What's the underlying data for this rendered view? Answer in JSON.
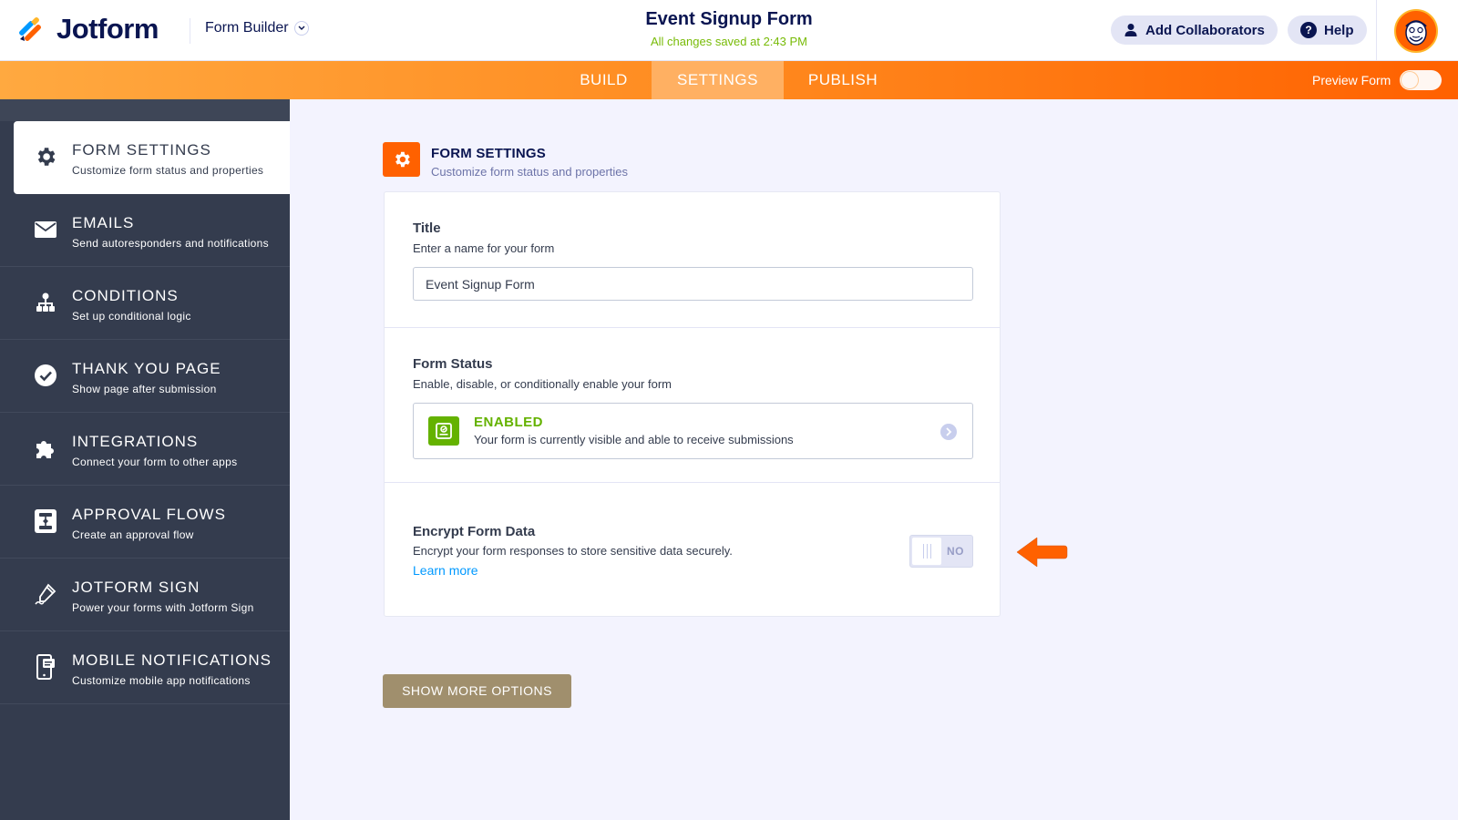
{
  "header": {
    "brand": "Jotform",
    "builder_label": "Form Builder",
    "form_name": "Event Signup Form",
    "save_status": "All changes saved at 2:43 PM",
    "collaborators_label": "Add Collaborators",
    "help_label": "Help"
  },
  "tabs": {
    "build": "BUILD",
    "settings": "SETTINGS",
    "publish": "PUBLISH",
    "active": "SETTINGS"
  },
  "preview": {
    "label": "Preview Form",
    "on": false
  },
  "sidebar": {
    "items": [
      {
        "title": "FORM SETTINGS",
        "subtitle": "Customize form status and properties",
        "icon": "gear-icon",
        "active": true
      },
      {
        "title": "EMAILS",
        "subtitle": "Send autoresponders and notifications",
        "icon": "envelope-icon"
      },
      {
        "title": "CONDITIONS",
        "subtitle": "Set up conditional logic",
        "icon": "hierarchy-icon"
      },
      {
        "title": "THANK YOU PAGE",
        "subtitle": "Show page after submission",
        "icon": "check-circle-icon"
      },
      {
        "title": "INTEGRATIONS",
        "subtitle": "Connect your form to other apps",
        "icon": "puzzle-icon"
      },
      {
        "title": "APPROVAL FLOWS",
        "subtitle": "Create an approval flow",
        "icon": "approval-flow-icon"
      },
      {
        "title": "JOTFORM SIGN",
        "subtitle": "Power your forms with Jotform Sign",
        "icon": "pen-sign-icon"
      },
      {
        "title": "MOBILE NOTIFICATIONS",
        "subtitle": "Customize mobile app notifications",
        "icon": "mobile-notification-icon"
      }
    ]
  },
  "main": {
    "section_title": "FORM SETTINGS",
    "section_subtitle": "Customize form status and properties",
    "title_field": {
      "label": "Title",
      "description": "Enter a name for your form",
      "value": "Event Signup Form"
    },
    "status_field": {
      "label": "Form Status",
      "description": "Enable, disable, or conditionally enable your form",
      "status": "ENABLED",
      "status_description": "Your form is currently visible and able to receive submissions"
    },
    "encrypt_field": {
      "label": "Encrypt Form Data",
      "description": "Encrypt your form responses to store sensitive data securely.",
      "link": "Learn more",
      "toggle_label": "NO",
      "enabled": false
    },
    "show_more_label": "SHOW MORE OPTIONS"
  },
  "colors": {
    "accent": "#ff6100",
    "enabled_green": "#64b200",
    "sidebar_bg": "#343c4e",
    "button_tan": "#a08f6d",
    "link_blue": "#0099ff"
  }
}
